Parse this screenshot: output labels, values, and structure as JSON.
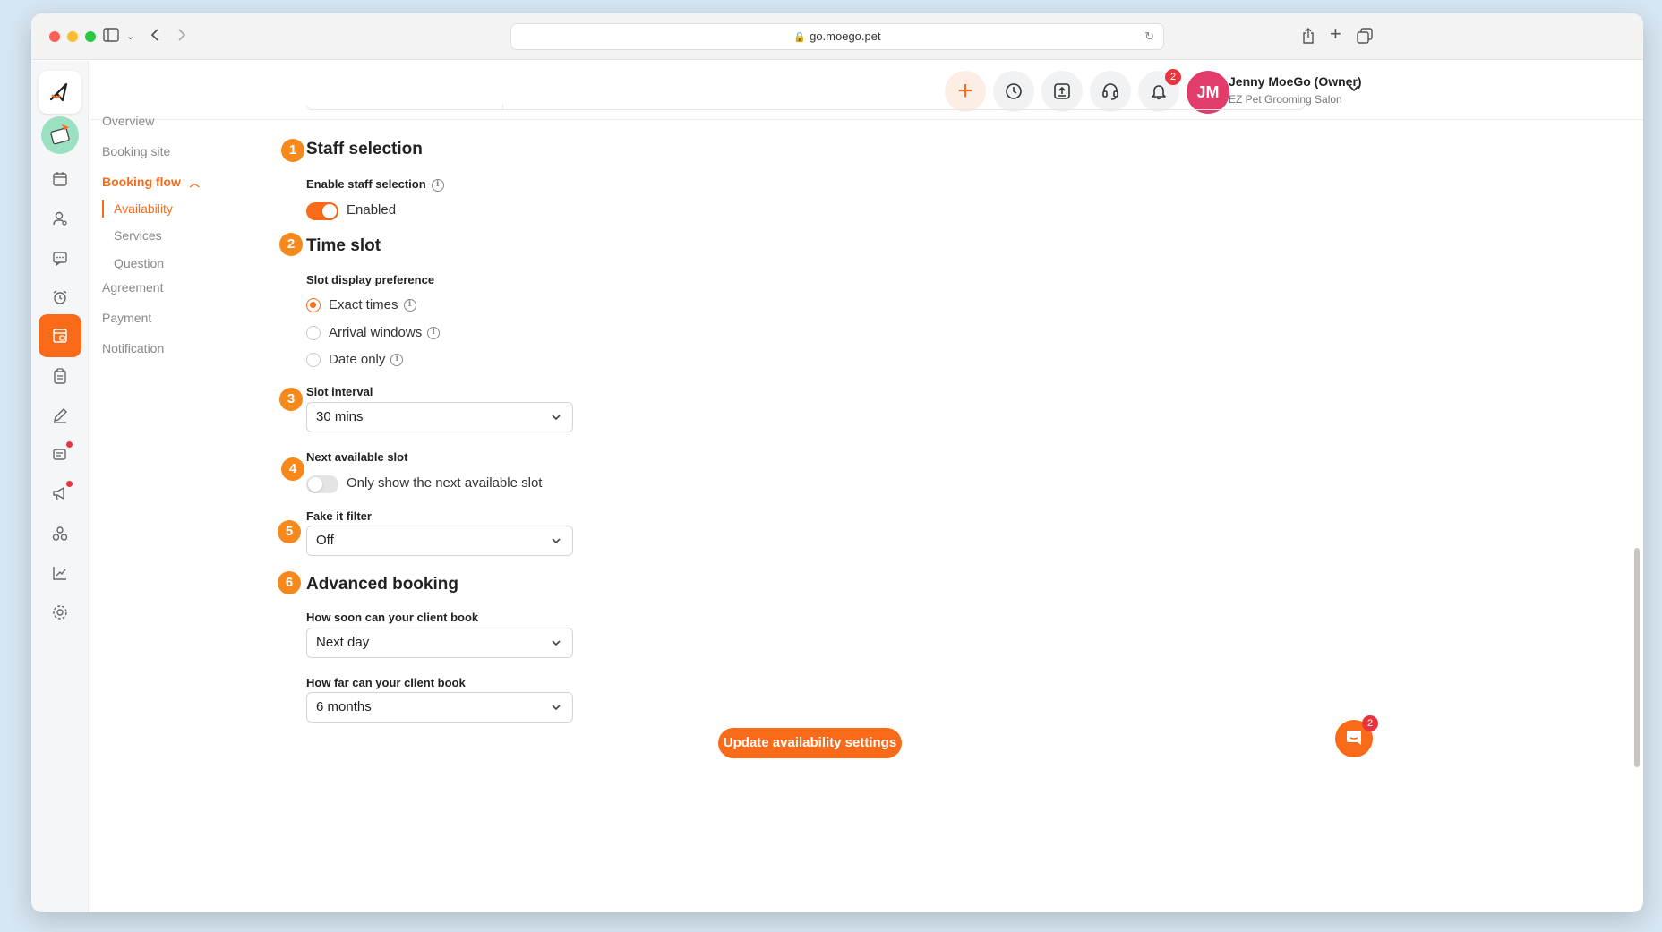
{
  "browser": {
    "url": "go.moego.pet"
  },
  "header": {
    "notification_count": "2",
    "user": {
      "initials": "JM",
      "name": "Jenny MoeGo (Owner)",
      "business": "EZ Pet Grooming Salon"
    }
  },
  "subnav": {
    "overview": "Overview",
    "booking_site": "Booking site",
    "booking_flow": "Booking flow",
    "availability": "Availability",
    "services": "Services",
    "question": "Question",
    "agreement": "Agreement",
    "payment": "Payment",
    "notification": "Notification"
  },
  "steps": [
    "1",
    "2",
    "3",
    "4",
    "5",
    "6"
  ],
  "staff_selection": {
    "title": "Staff selection",
    "label": "Enable staff selection",
    "toggle_label": "Enabled",
    "enabled": true
  },
  "time_slot": {
    "title": "Time slot",
    "display_label": "Slot display preference",
    "options": [
      "Exact times",
      "Arrival windows",
      "Date only"
    ],
    "selected": "Exact times"
  },
  "slot_interval": {
    "label": "Slot interval",
    "value": "30 mins"
  },
  "next_available": {
    "label": "Next available slot",
    "toggle_label": "Only show the next available slot",
    "enabled": false
  },
  "fake_it": {
    "label": "Fake it filter",
    "value": "Off"
  },
  "advanced_booking": {
    "title": "Advanced booking",
    "soon_label": "How soon can your client book",
    "soon_value": "Next day",
    "far_label": "How far can your client book",
    "far_value": "6 months"
  },
  "submit_label": "Update availability settings",
  "chat_badge": "2",
  "colors": {
    "accent": "#f96b18",
    "step": "#f7891c",
    "badge": "#e9343d",
    "avatar": "#e23c6a"
  }
}
